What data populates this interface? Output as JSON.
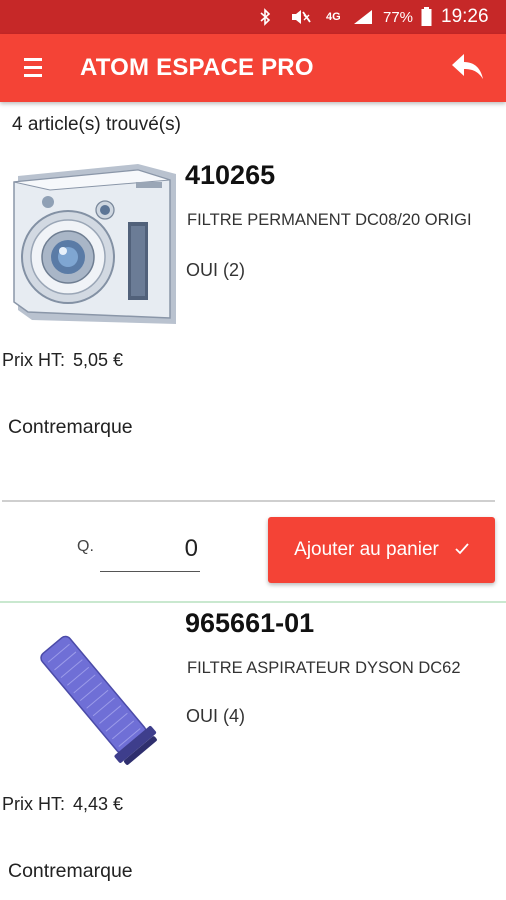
{
  "status_bar": {
    "network": "4G",
    "battery": "77%",
    "time": "19:26"
  },
  "app_bar": {
    "title": "ATOM ESPACE PRO"
  },
  "results_count": "4 article(s) trouvé(s)",
  "products": [
    {
      "reference": "410265",
      "description": "FILTRE PERMANENT DC08/20 ORIGI",
      "stock": "OUI (2)",
      "price_label": "Prix HT:",
      "price_value": "5,05 €",
      "tag": "Contremarque",
      "image_icon": "camera-icon"
    },
    {
      "reference": "965661-01",
      "description": "FILTRE ASPIRATEUR DYSON DC62",
      "stock": "OUI (4)",
      "price_label": "Prix HT:",
      "price_value": "4,43 €",
      "tag": "Contremarque",
      "image_icon": "filter-cartridge-icon"
    }
  ],
  "quantity": {
    "label": "Q.",
    "value": "0"
  },
  "add_to_cart": {
    "label": "Ajouter au panier"
  },
  "colors": {
    "status_bar": "#c62828",
    "app_bar": "#f44336",
    "button": "#f44336",
    "divider_green": "#c9e8cf"
  }
}
